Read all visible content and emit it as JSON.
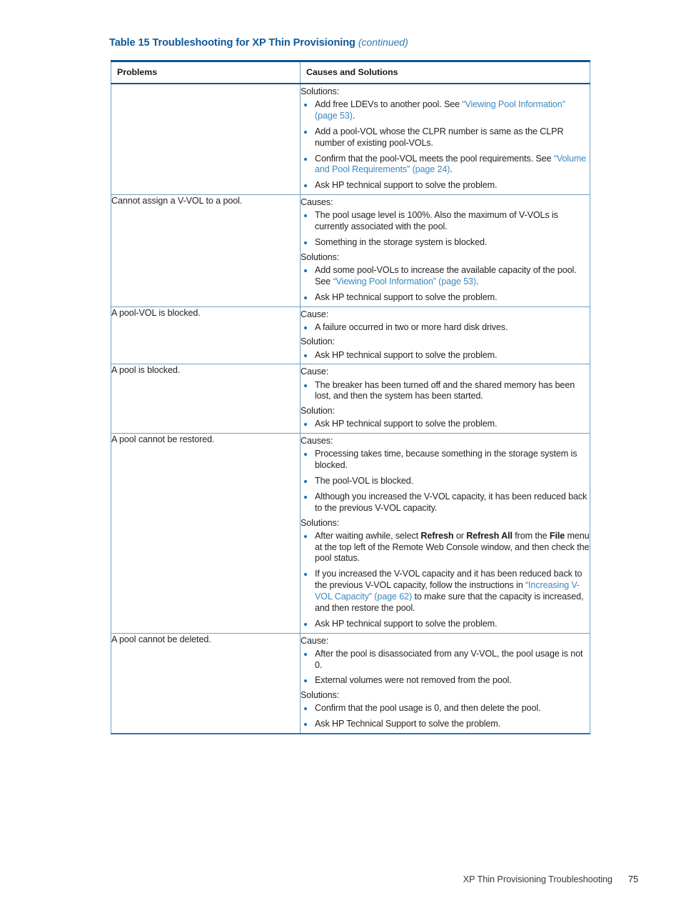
{
  "page": {
    "footer_section": "XP Thin Provisioning Troubleshooting",
    "footer_page_number": "75"
  },
  "colors": {
    "caption": "#11589c",
    "header_rule": "#0b5693",
    "cell_border": "#6f9fc4",
    "bottom_rule": "#2f72a8",
    "link": "#3a87be",
    "bullet": "#1d6fae",
    "text": "#231f20"
  },
  "table": {
    "caption_main": "Table 15 Troubleshooting for XP Thin Provisioning",
    "caption_continued": "(continued)",
    "columns": [
      "Problems",
      "Causes and Solutions"
    ],
    "rows": [
      {
        "problem": "",
        "blocks": [
          {
            "lead": "Solutions:",
            "items": [
              "Add free LDEVs to another pool. See “Viewing Pool Information” (page 53).",
              "Add a pool-VOL whose the CLPR number is same as the CLPR number of existing pool-VOLs.",
              "Confirm that the pool-VOL meets the pool requirements. See “Volume and Pool Requirements” (page 24).",
              "Ask HP technical support to solve the problem."
            ]
          }
        ]
      },
      {
        "problem": "Cannot assign a V-VOL to a pool.",
        "blocks": [
          {
            "lead": "Causes:",
            "items": [
              "The pool usage level is 100%. Also the maximum of V-VOLs is currently associated with the pool.",
              "Something in the storage system is blocked."
            ]
          },
          {
            "lead": "Solutions:",
            "items": [
              "Add some pool-VOLs to increase the available capacity of the pool. See “Viewing Pool Information” (page 53).",
              "Ask HP technical support to solve the problem."
            ]
          }
        ]
      },
      {
        "problem": "A pool-VOL is blocked.",
        "blocks": [
          {
            "lead": "Cause:",
            "items": [
              "A failure occurred in two or more hard disk drives."
            ]
          },
          {
            "lead": "Solution:",
            "items": [
              "Ask HP technical support to solve the problem."
            ]
          }
        ]
      },
      {
        "problem": "A pool is blocked.",
        "blocks": [
          {
            "lead": "Cause:",
            "items": [
              "The breaker has been turned off and the shared memory has been lost, and then the system has been started."
            ]
          },
          {
            "lead": "Solution:",
            "items": [
              "Ask HP technical support to solve the problem."
            ]
          }
        ]
      },
      {
        "problem": "A pool cannot be restored.",
        "blocks": [
          {
            "lead": "Causes:",
            "items": [
              "Processing takes time, because something in the storage system is blocked.",
              "The pool-VOL is blocked.",
              "Although you increased the V-VOL capacity, it has been reduced back to the previous V-VOL capacity."
            ]
          },
          {
            "lead": "Solutions:",
            "items": [
              "After waiting awhile, select Refresh or Refresh All from the File menu at the top left of the Remote Web Console window, and then check the pool status.",
              "If you increased the V-VOL capacity and it has been reduced back to the previous V-VOL capacity, follow the instructions in “Increasing V-VOL Capacity” (page 62) to make sure that the capacity is increased, and then restore the pool.",
              "Ask HP technical support to solve the problem."
            ]
          }
        ]
      },
      {
        "problem": "A pool cannot be deleted.",
        "blocks": [
          {
            "lead": "Cause:",
            "items": [
              "After the pool is disassociated from any V-VOL, the pool usage is not 0.",
              "External volumes were not removed from the pool."
            ]
          },
          {
            "lead": "Solutions:",
            "items": [
              "Confirm that the pool usage is 0, and then delete the pool.",
              "Ask HP Technical Support to solve the problem."
            ]
          }
        ]
      }
    ],
    "inline_emphasis": {
      "links": [
        "“Viewing Pool Information” (page 53)",
        "“Volume and Pool Requirements” (page 24)",
        "“Increasing V-VOL Capacity” (page 62)"
      ],
      "bold_terms": [
        "Refresh",
        "Refresh All",
        "File"
      ]
    }
  }
}
